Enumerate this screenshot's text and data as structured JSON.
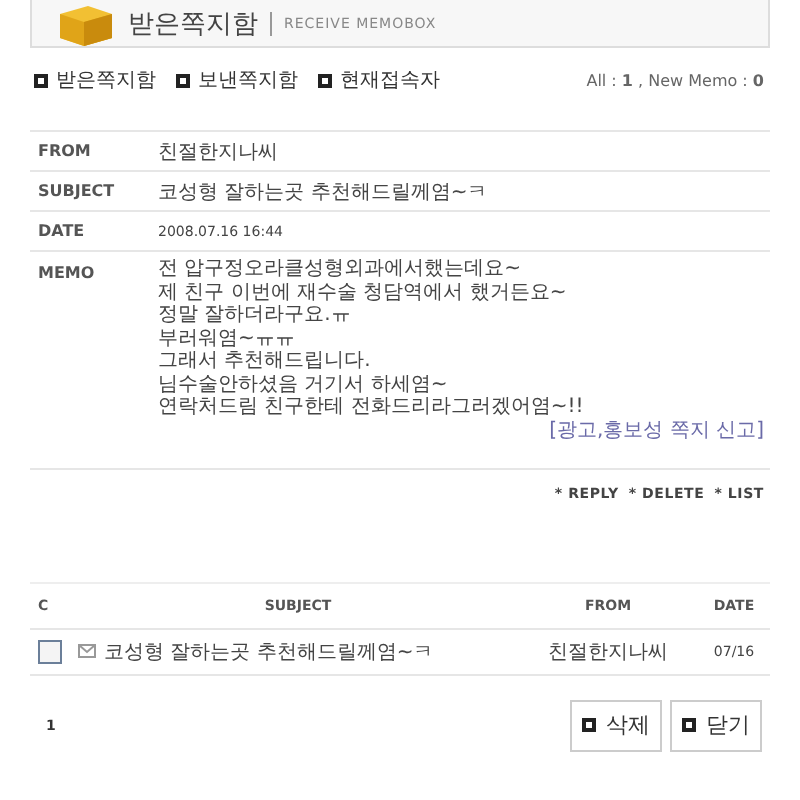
{
  "header": {
    "title": "받은쪽지함",
    "subtitle": "RECEIVE MEMOBOX"
  },
  "nav": [
    "받은쪽지함",
    "보낸쪽지함",
    "현재접속자"
  ],
  "counts": "All : **1** , New Memo : **0**",
  "message": {
    "fields": [
      {
        "label": "FROM",
        "value": "친절한지나씨",
        "kind": "text"
      },
      {
        "label": "SUBJECT",
        "value": "코성형 잘하는곳 추천해드릴께염~ㅋ",
        "kind": "text"
      },
      {
        "label": "DATE",
        "value": "2008.07.16 16:44",
        "kind": "date"
      }
    ],
    "memo_label": "MEMO",
    "memo_lines": [
      "전 압구정오라클성형외과에서했는데요~",
      "제 친구 이번에 재수술 청담역에서 했거든요~",
      "정말 잘하더라구요.ㅠ",
      "부러워염~ㅠㅠ",
      "그래서 추천해드립니다.",
      "님수술안하셨음 거기서 하세염~",
      "연락처드림 친구한테 전화드리라그러겠어염~!!"
    ],
    "report_link": "[광고,홍보성 쪽지 신고]"
  },
  "actions": [
    "* REPLY",
    "* DELETE",
    "* LIST"
  ],
  "list": {
    "columns": [
      "C",
      "SUBJECT",
      "FROM",
      "DATE"
    ],
    "rows": [
      {
        "checked": false,
        "subject": "코성형 잘하는곳 추천해드릴께염~ㅋ",
        "from": "친절한지나씨",
        "date": "07/16"
      }
    ]
  },
  "page": "1",
  "buttons": [
    "삭제",
    "닫기"
  ]
}
